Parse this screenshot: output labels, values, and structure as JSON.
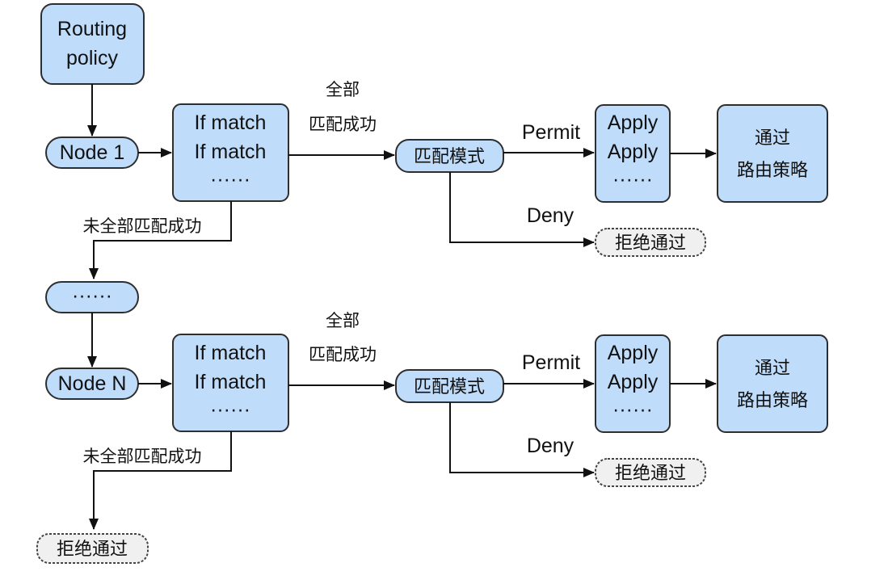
{
  "routing_policy": {
    "line1": "Routing",
    "line2": "policy"
  },
  "sections": [
    {
      "node": "Node 1",
      "match": {
        "line1": "If match",
        "line2": "If match",
        "line3": "······"
      },
      "all_match": {
        "line1": "全部",
        "line2": "匹配成功"
      },
      "mode": "匹配模式",
      "permit": "Permit",
      "apply": {
        "line1": "Apply",
        "line2": "Apply",
        "line3": "······"
      },
      "pass": {
        "line1": "通过",
        "line2": "路由策略"
      },
      "deny": "Deny",
      "reject": "拒绝通过",
      "not_all_match": "未全部匹配成功"
    },
    {
      "node": "Node N",
      "match": {
        "line1": "If match",
        "line2": "If match",
        "line3": "······"
      },
      "all_match": {
        "line1": "全部",
        "line2": "匹配成功"
      },
      "mode": "匹配模式",
      "permit": "Permit",
      "apply": {
        "line1": "Apply",
        "line2": "Apply",
        "line3": "······"
      },
      "pass": {
        "line1": "通过",
        "line2": "路由策略"
      },
      "deny": "Deny",
      "reject": "拒绝通过",
      "not_all_match": "未全部匹配成功"
    }
  ],
  "ellipsis_node": "······",
  "final_reject": "拒绝通过",
  "colors": {
    "box_fill": "#bfdcfb",
    "reject_fill": "#f0f0f0",
    "line": "#111111"
  }
}
